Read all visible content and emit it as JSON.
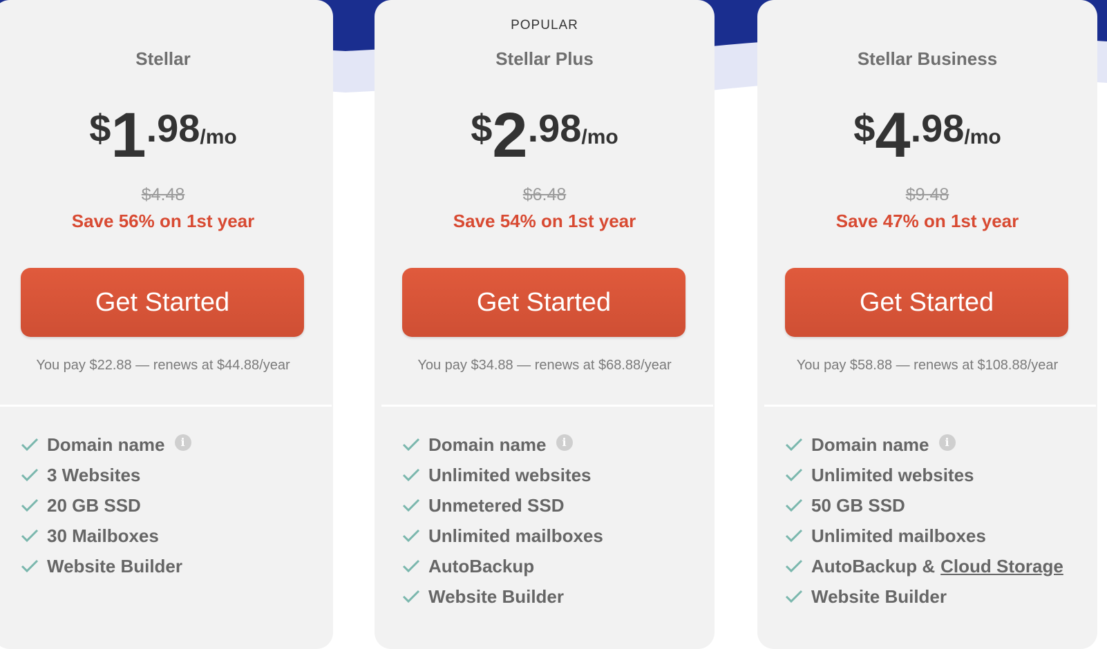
{
  "colors": {
    "card_bg": "#f2f2f2",
    "navy": "#1a2e8f",
    "lavender": "#e3e6f6",
    "accent": "#d84a32",
    "check": "#7ab7ad"
  },
  "icons": {
    "check": "check-icon",
    "info": "info-icon"
  },
  "plans": [
    {
      "badge": "",
      "name": "Stellar",
      "currency": "$",
      "price_int": "1",
      "price_dec": ".98",
      "per": "/mo",
      "old_price": "$4.48",
      "save": "Save 56% on 1st year",
      "cta": "Get Started",
      "pay": "You pay $22.88 — renews at $44.88/year",
      "features": [
        "Domain name",
        "3 Websites",
        "20 GB SSD",
        "30 Mailboxes",
        "Website Builder"
      ]
    },
    {
      "badge": "POPULAR",
      "name": "Stellar Plus",
      "currency": "$",
      "price_int": "2",
      "price_dec": ".98",
      "per": "/mo",
      "old_price": "$6.48",
      "save": "Save 54% on 1st year",
      "cta": "Get Started",
      "pay": "You pay $34.88 — renews at $68.88/year",
      "features": [
        "Domain name",
        "Unlimited websites",
        "Unmetered SSD",
        "Unlimited mailboxes",
        "AutoBackup",
        "Website Builder"
      ]
    },
    {
      "badge": "",
      "name": "Stellar Business",
      "currency": "$",
      "price_int": "4",
      "price_dec": ".98",
      "per": "/mo",
      "old_price": "$9.48",
      "save": "Save 47% on 1st year",
      "cta": "Get Started",
      "pay": "You pay $58.88 — renews at $108.88/year",
      "features": [
        "Domain name",
        "Unlimited websites",
        "50 GB SSD",
        "Unlimited mailboxes",
        "AutoBackup &",
        "Website Builder"
      ],
      "feature_link": "Cloud Storage"
    }
  ]
}
